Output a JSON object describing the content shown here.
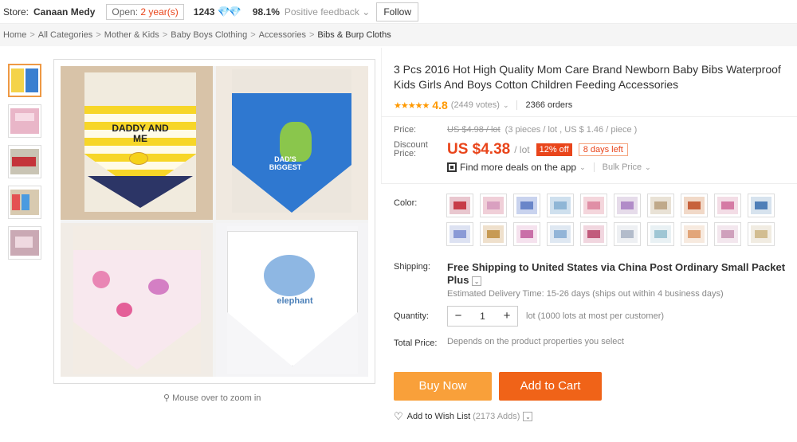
{
  "store": {
    "label": "Store:",
    "name": "Canaan Medy",
    "open_prefix": "Open:",
    "open_years": "2 year(s)",
    "feedback_count": "1243",
    "diamonds": "💎💎",
    "positive_pct": "98.1%",
    "positive_label": "Positive feedback",
    "chevron": "⌄",
    "follow_label": "Follow"
  },
  "breadcrumb": [
    "Home",
    "All Categories",
    "Mother & Kids",
    "Baby Boys Clothing",
    "Accessories",
    "Bibs & Burp Cloths"
  ],
  "breadcrumb_sep": ">",
  "image": {
    "zoom_hint": "Mouse over to zoom in"
  },
  "main_bibs": {
    "q1_text": "DADDY AND ME",
    "q2_text": "DAD'S BIGGEST",
    "q4_text": "elephant"
  },
  "product": {
    "title": "3 Pcs 2016 Hot High Quality Mom Care Brand Newborn Baby Bibs Waterproof Kids Girls And Boys Cotton Children Feeding Accessories",
    "stars": "★★★★★",
    "rating": "4.8",
    "votes": "(2449 votes)",
    "orders": "2366 orders"
  },
  "price": {
    "label": "Price:",
    "old": "US $4.98 / lot",
    "note": "(3 pieces / lot , US $ 1.46 / piece )",
    "discount_label_1": "Discount",
    "discount_label_2": "Price:",
    "now": "US $4.38",
    "per": "/ lot",
    "off": "12% off",
    "days_left": "8 days left",
    "deals": "Find more deals on the app",
    "bulk": "Bulk Price"
  },
  "color": {
    "label": "Color:",
    "swatch_count": 20
  },
  "shipping": {
    "label": "Shipping:",
    "text": "Free Shipping to United States via China Post Ordinary Small Packet Plus",
    "eta": "Estimated Delivery Time: 15-26 days (ships out within 4 business days)"
  },
  "quantity": {
    "label": "Quantity:",
    "minus": "−",
    "value": "1",
    "plus": "+",
    "note": "lot (1000 lots at most per customer)"
  },
  "total": {
    "label": "Total Price:",
    "value": "Depends on the product properties you select"
  },
  "actions": {
    "buy_now": "Buy Now",
    "add_to_cart": "Add to Cart",
    "heart": "♡",
    "wish_label": "Add to Wish List",
    "wish_count": "(2173 Adds)"
  },
  "colors": {
    "accent": "#e9451b",
    "buy": "#f9a03a",
    "cart": "#f06318",
    "star": "#ff9900"
  }
}
